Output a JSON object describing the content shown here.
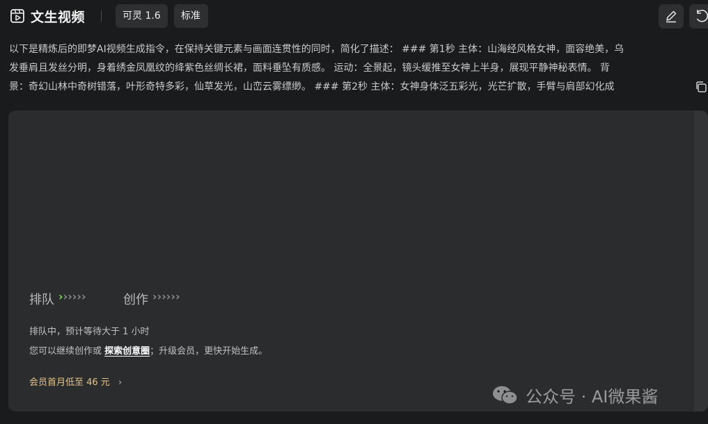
{
  "header": {
    "title": "文生视频",
    "model_chip": "可灵 1.6",
    "quality_chip": "标准",
    "icons": [
      "video-icon",
      "edit-icon",
      "retry-icon"
    ]
  },
  "prompt": {
    "lines": [
      "以下是精炼后的即梦AI视频生成指令，在保持关键元素与画面连贯性的同时，简化了描述： ### 第1秒 主体：山海经风格女神，面容绝美，乌",
      "发垂肩且发丝分明，身着绣金凤凰纹的绛紫色丝绸长裙，面料垂坠有质感。 运动：全景起，镜头缓推至女神上半身，展现平静神秘表情。 背",
      "景：奇幻山林中奇树错落，叶形奇特多彩，仙草发光，山峦云雾缥缈。 ### 第2秒 主体：女神身体泛五彩光，光芒扩散，手臂与肩部幻化成"
    ],
    "copy_icon": "copy-icon"
  },
  "card": {
    "step_queue": "排队",
    "step_create": "创作",
    "chevrons": "››››››",
    "status_line_1": "排队中，预计等待大于 1 小时",
    "status_line_2_prefix": "您可以继续创作或",
    "status_link": "探索创意圈",
    "status_line_2_suffix": "；升级会员，更快开始生成。",
    "promo": "会员首月低至 46 元",
    "promo_arrow": "›",
    "accent_color": "#7fdc55",
    "promo_color": "#e5c48a"
  },
  "watermark": {
    "text": "公众号 · AI微果酱",
    "logo_icon": "wechat-icon"
  }
}
